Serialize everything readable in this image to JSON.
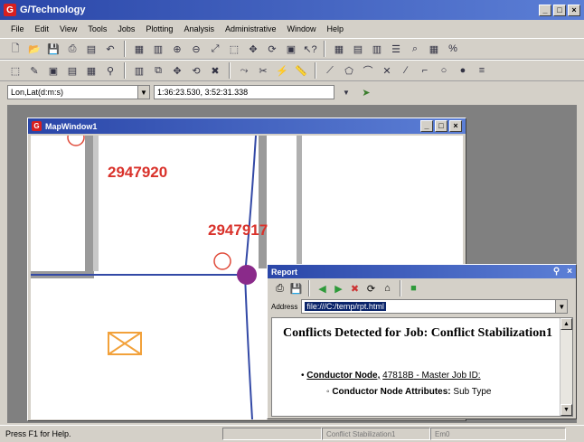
{
  "app": {
    "title": "G/Technology"
  },
  "menu": [
    "File",
    "Edit",
    "View",
    "Tools",
    "Jobs",
    "Plotting",
    "Analysis",
    "Administrative",
    "Window",
    "Help"
  ],
  "coords": {
    "system": "Lon,Lat(d:m:s)",
    "value": "1:36:23.530, 3:52:31.338"
  },
  "map_window": {
    "title": "MapWindow1",
    "labels": {
      "parcel_a": "2947920",
      "parcel_b": "2947917"
    }
  },
  "report": {
    "title": "Report",
    "address_label": "Address",
    "address_value": "file:///C:/temp/rpt.html",
    "heading": "Conflicts Detected for Job: Conflict Stabilization1",
    "item_link": "Conductor Node,",
    "item_id": "47818B",
    "item_rest": " - Master Job ID:",
    "sub_label": "Conductor Node Attributes:",
    "sub_value": " Sub Type"
  },
  "status": {
    "help": "Press F1 for Help.",
    "job": "Conflict Stabilization1",
    "field3": "Em0"
  },
  "colors": {
    "title_bar": "#2a46a8",
    "map_label": "#d9322b",
    "conductor_line": "#3349a6",
    "node": "#8a2a8a"
  }
}
